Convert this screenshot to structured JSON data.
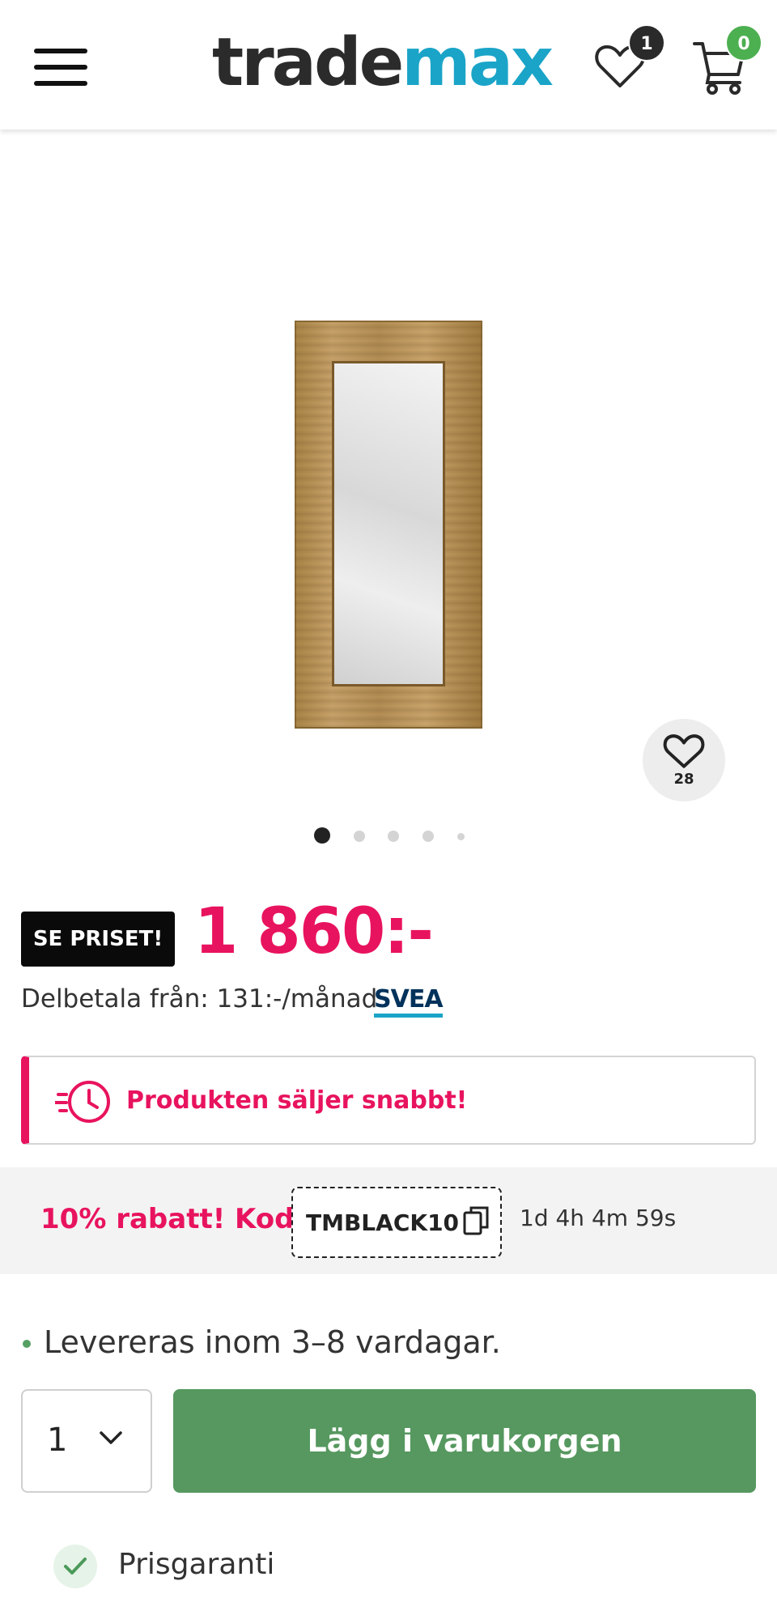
{
  "header": {
    "logo_part1": "trade",
    "logo_part2": "max",
    "wishlist_count": "1",
    "cart_count": "0",
    "icons": [
      "menu-icon",
      "heart-icon",
      "cart-icon"
    ]
  },
  "product": {
    "favorites_count": "28",
    "image_count": 5,
    "active_image": 1
  },
  "price": {
    "badge": "SE PRISET!",
    "amount": "1 860:-",
    "installment": "Delbetala från: 131:-/månad",
    "provider_logo": "SVEA"
  },
  "alert": {
    "text": "Produkten säljer snabbt!"
  },
  "discount": {
    "label": "10% rabatt! Kod:",
    "code": "TMBLACK10",
    "countdown": "1d 4h 4m 59s"
  },
  "delivery": {
    "text": "Levereras inom 3–8 vardagar."
  },
  "purchase": {
    "quantity": "1",
    "add_to_cart_label": "Lägg i varukorgen"
  },
  "benefits": {
    "first": "Prisgaranti"
  },
  "colors": {
    "brand_pink": "#e8135e",
    "brand_blue": "#1aa4c8",
    "button_green": "#56985f"
  }
}
